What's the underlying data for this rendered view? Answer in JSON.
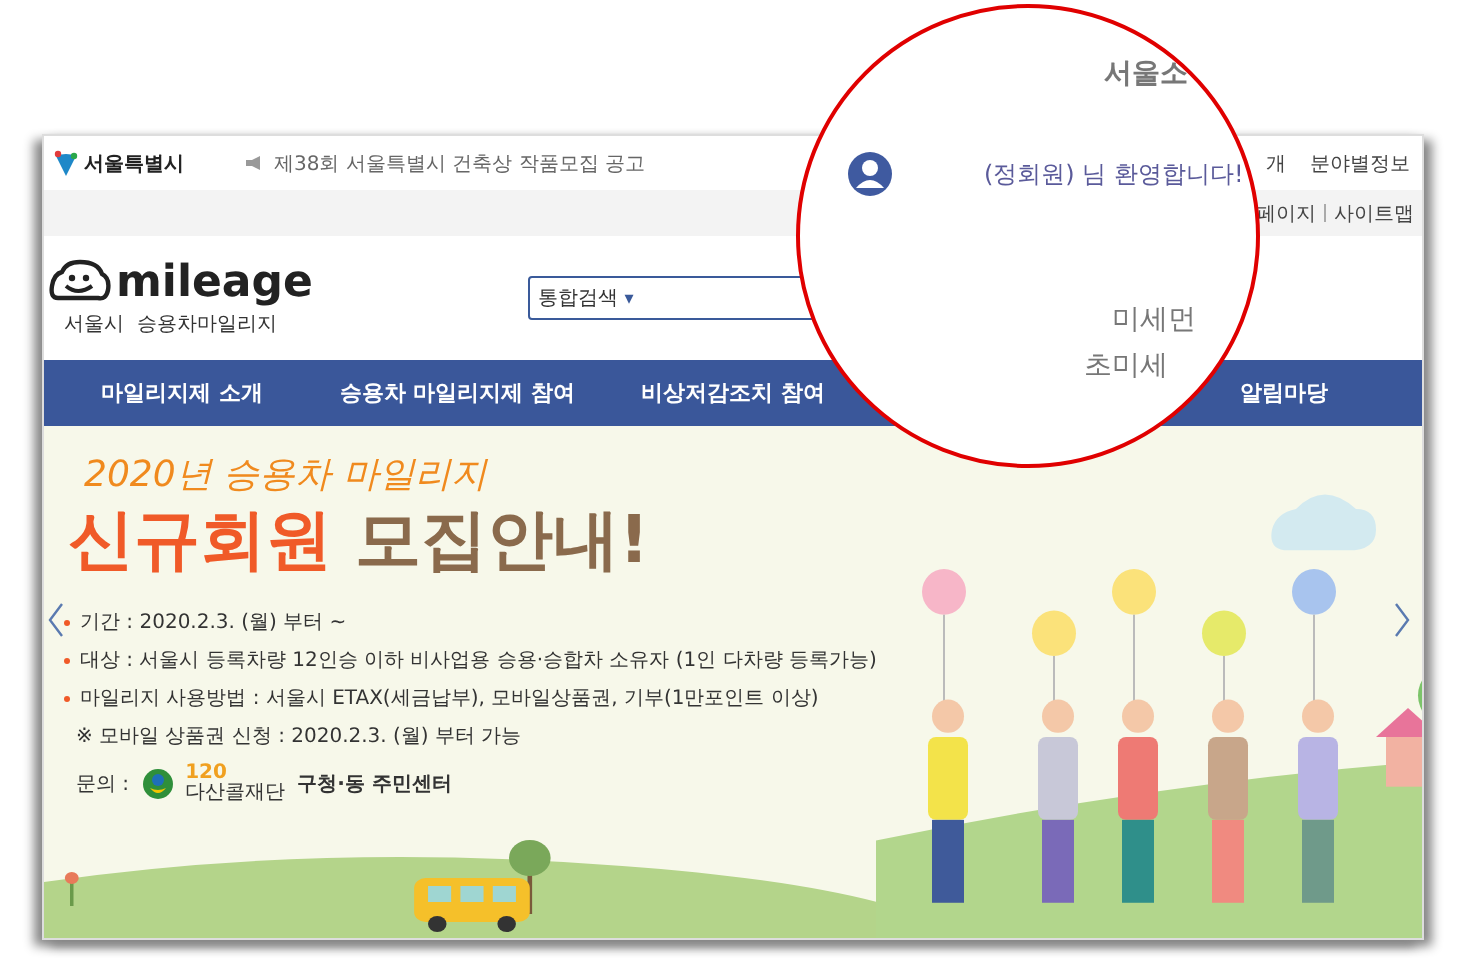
{
  "top_bar": {
    "logo_text": "서울특별시",
    "notice": "제38회 서울특별시 건축상 작품모집 공고",
    "links": [
      "개",
      "분야별정보"
    ]
  },
  "sub_bar": {
    "links": [
      "페이지",
      "사이트맵"
    ]
  },
  "header": {
    "logo": "mileage",
    "subtitle": "서울시  승용차마일리지",
    "search": {
      "scope": "통합검색",
      "caret": "▾"
    }
  },
  "nav": {
    "items": [
      "마일리지제 소개",
      "승용차 마일리지제 참여",
      "비상저감조치 참여",
      "알림마당"
    ]
  },
  "banner": {
    "kicker": "2020년 승용차 마일리지",
    "headline_accent": "신규회원",
    "headline_rest": "모집안내!",
    "bullets": [
      {
        "kind": "dot",
        "text": "기간 : 2020.2.3. (월) 부터 ~"
      },
      {
        "kind": "dot",
        "text": "대상 : 서울시 등록차량 12인승 이하 비사업용 승용·승합차 소유자 (1인 다차량 등록가능)"
      },
      {
        "kind": "dot",
        "text": "마일리지 사용방법 : 서울시 ETAX(세금납부), 모바일상품권, 기부(1만포인트 이상)"
      },
      {
        "kind": "note",
        "text": "※ 모바일 상품권 신청 : 2020.2.3. (월) 부터 가능"
      }
    ],
    "contact": {
      "label": "문의 :",
      "call_number": "120",
      "call_name": "다산콜재단",
      "other": "구청·동 주민센터"
    }
  },
  "magnifier": {
    "top_text": "서울소",
    "welcome": "(정회원) 님 환영합니다!",
    "dust_lines": [
      "미세먼",
      "초미세"
    ]
  }
}
